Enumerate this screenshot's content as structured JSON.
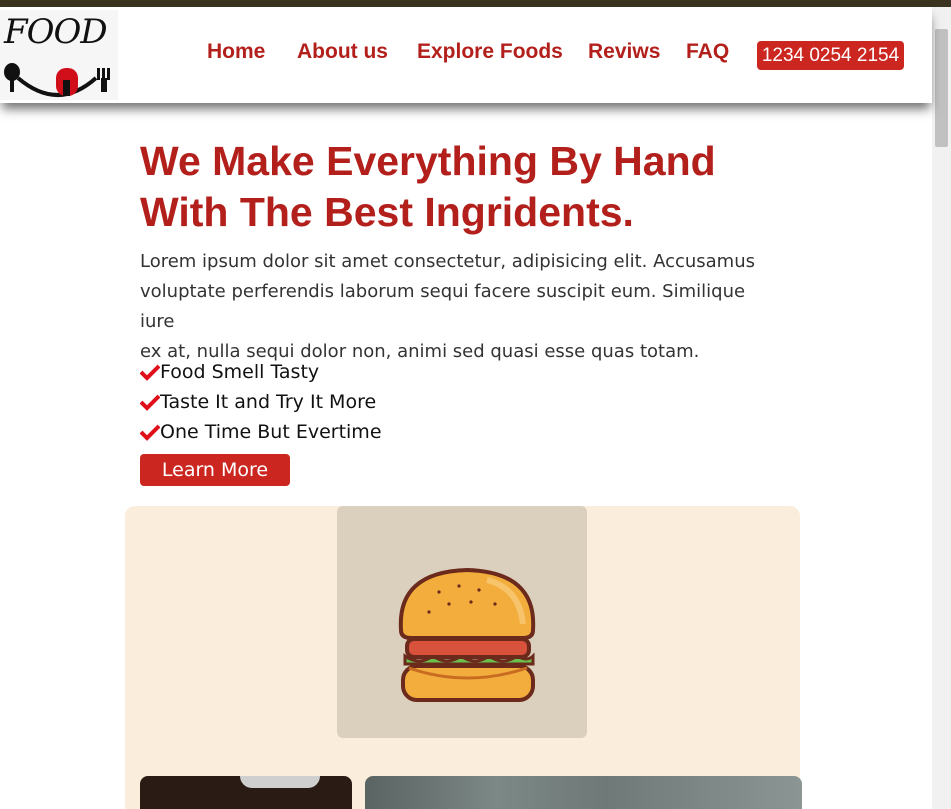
{
  "brand": {
    "logo_text": "FOOD"
  },
  "nav": {
    "items": [
      "Home",
      "About us",
      "Explore Foods",
      "Reviws",
      "FAQ"
    ],
    "phone": "1234 0254 2154"
  },
  "hero": {
    "headline_line1": "We Make Everything By Hand",
    "headline_line2": "With The Best Ingridents.",
    "paragraph_line1": "Lorem ipsum dolor sit amet consectetur, adipisicing elit. Accusamus",
    "paragraph_line2": "voluptate perferendis laborum sequi facere suscipit eum. Similique iure",
    "paragraph_line3": "ex at, nulla sequi dolor non, animi sed quasi esse quas totam.",
    "features": [
      "Food Smell Tasty",
      "Taste It and Try It More",
      "One Time But Evertime"
    ],
    "button_label": "Learn More"
  },
  "icons": {
    "check": "check-icon",
    "burger": "burger-illustration"
  },
  "colors": {
    "accent": "#b3201c",
    "button": "#cc2620",
    "cream": "#faeddb",
    "top_strip": "#3a3320"
  }
}
